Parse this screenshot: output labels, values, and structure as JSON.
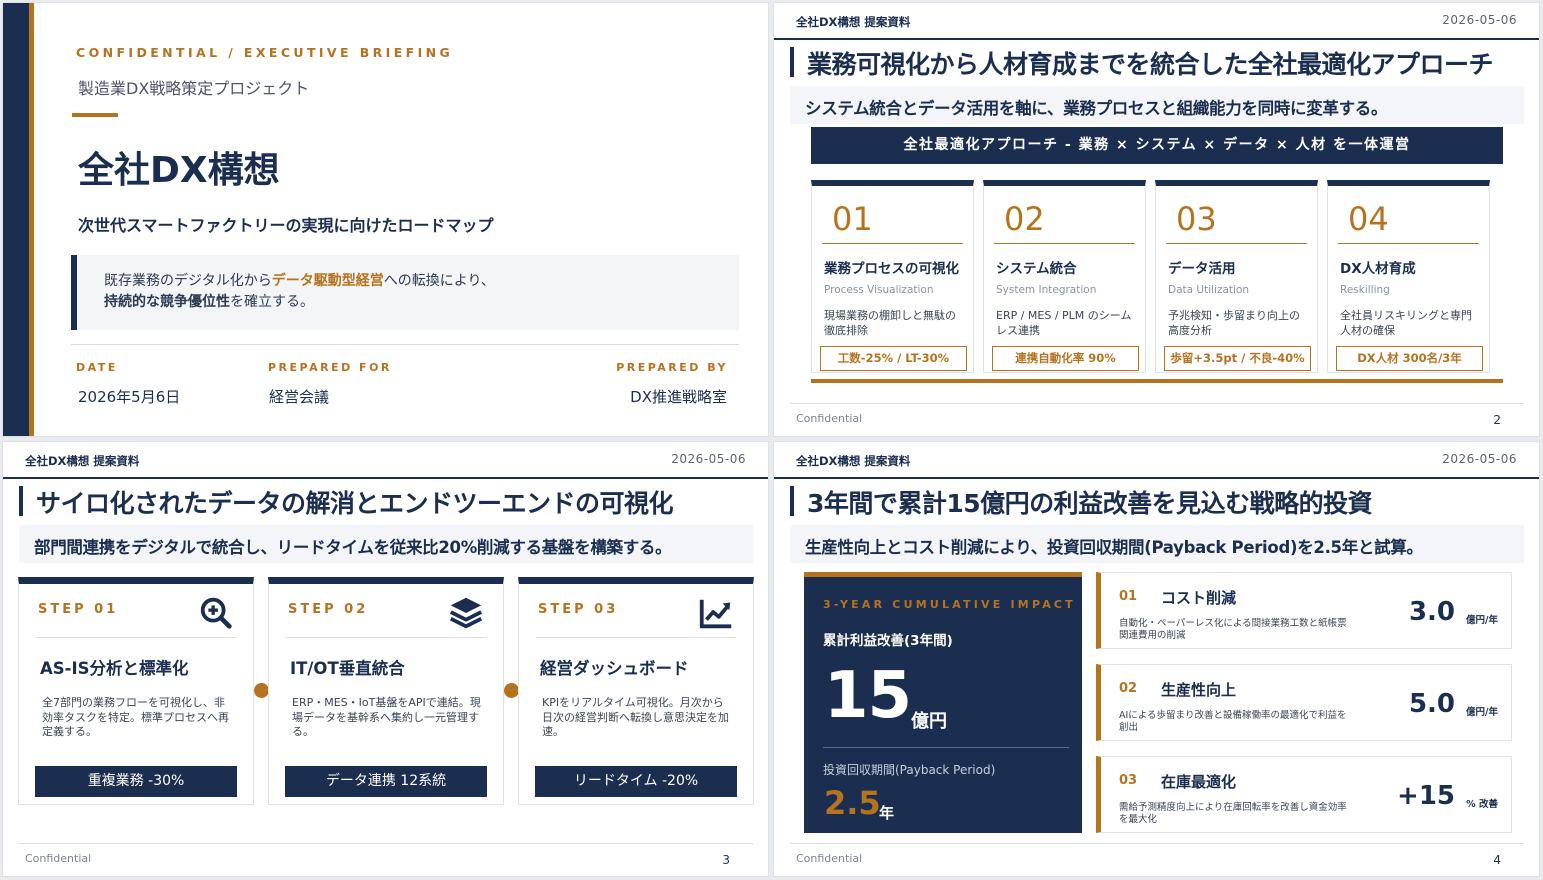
{
  "slide1": {
    "eyebrow": "CONFIDENTIAL  /  EXECUTIVE BRIEFING",
    "project": "製造業DX戦略策定プロジェクト",
    "title": "全社DX構想",
    "subtitle": "次世代スマートファクトリーの実現に向けたロードマップ",
    "quote_pre": "既存業務のデジタル化から",
    "quote_highlight": "データ駆動型経営",
    "quote_mid": "への転換により、",
    "quote_bold": "持続的な競争優位性",
    "quote_post": "を確立する。",
    "meta": [
      {
        "label": "DATE",
        "value": "2026年5月6日"
      },
      {
        "label": "PREPARED FOR",
        "value": "経営会議"
      },
      {
        "label": "PREPARED BY",
        "value": "DX推進戦略室"
      }
    ]
  },
  "header": {
    "doc_title": "全社DX構想 提案資料",
    "date": "2026-05-06",
    "confidential": "Confidential"
  },
  "slide2": {
    "title": "業務可視化から人材育成までを統合した全社最適化アプローチ",
    "lead": "システム統合とデータ活用を軸に、業務プロセスと組織能力を同時に変革する。",
    "banner": "全社最適化アプローチ - 業務 × システム × データ × 人材 を一体運営",
    "page": "2",
    "cards": [
      {
        "num": "01",
        "title": "業務プロセスの可視化",
        "en": "Process Visualization",
        "desc": "現場業務の棚卸しと無駄の徹底排除",
        "kpi": "工数-25% / LT-30%"
      },
      {
        "num": "02",
        "title": "システム統合",
        "en": "System Integration",
        "desc": "ERP / MES / PLM のシームレス連携",
        "kpi": "連携自動化率 90%"
      },
      {
        "num": "03",
        "title": "データ活用",
        "en": "Data Utilization",
        "desc": "予兆検知・歩留まり向上の高度分析",
        "kpi": "歩留+3.5pt / 不良-40%"
      },
      {
        "num": "04",
        "title": "DX人材育成",
        "en": "Reskilling",
        "desc": "全社員リスキリングと専門人材の確保",
        "kpi": "DX人材 300名/3年"
      }
    ]
  },
  "slide3": {
    "title": "サイロ化されたデータの解消とエンドツーエンドの可視化",
    "lead": "部門間連携をデジタルで統合し、リードタイムを従来比20%削減する基盤を構築する。",
    "page": "3",
    "steps": [
      {
        "label": "STEP 01",
        "icon": "zoom-in-icon",
        "title": "AS-IS分析と標準化",
        "desc": "全7部門の業務フローを可視化し、非効率タスクを特定。標準プロセスへ再定義する。",
        "kpi": "重複業務 -30%"
      },
      {
        "label": "STEP 02",
        "icon": "layers-icon",
        "title": "IT/OT垂直統合",
        "desc": "ERP・MES・IoT基盤をAPIで連結。現場データを基幹系へ集約し一元管理する。",
        "kpi": "データ連携 12系統"
      },
      {
        "label": "STEP 03",
        "icon": "trend-chart-icon",
        "title": "経営ダッシュボード",
        "desc": "KPIをリアルタイム可視化。月次から日次の経営判断へ転換し意思決定を加速。",
        "kpi": "リードタイム -20%"
      }
    ]
  },
  "slide4": {
    "title": "3年間で累計15億円の利益改善を見込む戦略的投資",
    "lead": "生産性向上とコスト削減により、投資回収期間(Payback Period)を2.5年と試算。",
    "page": "4",
    "impact": {
      "eyebrow": "3-YEAR CUMULATIVE IMPACT",
      "label": "累計利益改善(3年間)",
      "value": "15",
      "unit": "億円",
      "payback_label": "投資回収期間(Payback Period)",
      "payback_value": "2.5",
      "payback_unit": "年"
    },
    "items": [
      {
        "num": "01",
        "title": "コスト削減",
        "desc": "自動化・ペーパーレス化による間接業務工数と紙帳票関連費用の削減",
        "value": "3.0",
        "unit": "億円/年"
      },
      {
        "num": "02",
        "title": "生産性向上",
        "desc": "AIによる歩留まり改善と設備稼働率の最適化で利益を創出",
        "value": "5.0",
        "unit": "億円/年"
      },
      {
        "num": "03",
        "title": "在庫最適化",
        "desc": "需給予測精度向上により在庫回転率を改善し資金効率を最大化",
        "value": "+15",
        "unit": "% 改善"
      }
    ]
  }
}
